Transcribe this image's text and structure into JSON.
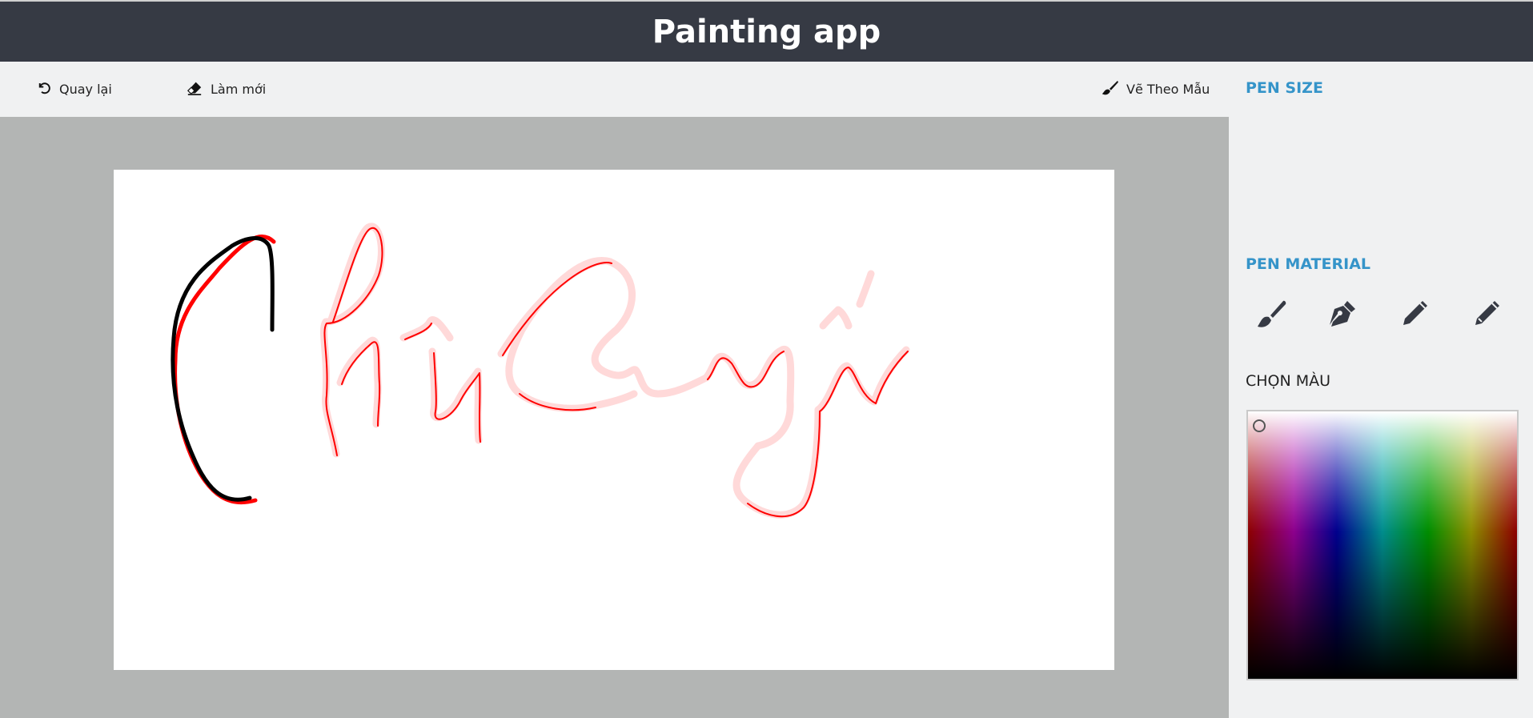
{
  "app": {
    "title": "Painting app"
  },
  "toolbar": {
    "undo_label": "Quay lại",
    "clear_label": "Làm mới",
    "template_label": "Vẽ Theo Mẫu"
  },
  "sidebar": {
    "pen_size_title": "PEN SIZE",
    "pen_material_title": "PEN MATERIAL",
    "materials": [
      "paint-brush-icon",
      "fountain-pen-icon",
      "pencil-icon",
      "pencil-outline-icon"
    ],
    "color_title": "CHỌN MÀU"
  },
  "canvas": {
    "template_stroke_color": "#ff0000",
    "template_glow_color": "#ffd6d6",
    "user_stroke_color": "#000000"
  },
  "colors": {
    "header_bg": "#363a44",
    "accent": "#3594c9",
    "panel_bg": "#f0f1f2",
    "canvas_surround": "#b3b5b4"
  }
}
